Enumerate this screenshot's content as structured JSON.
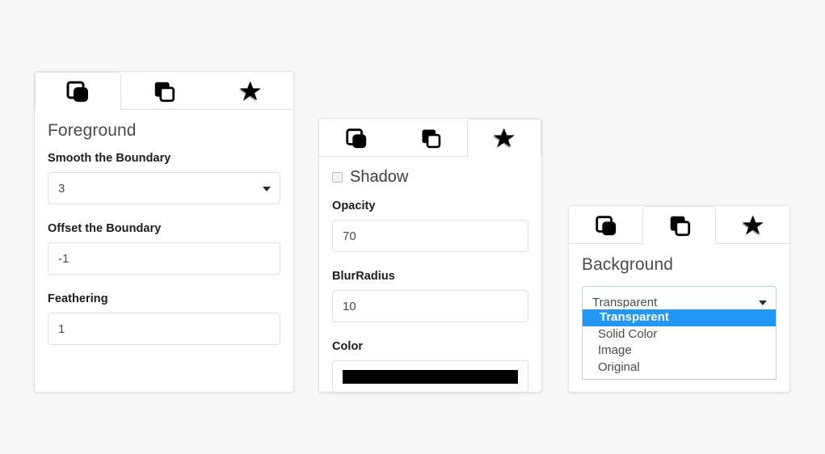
{
  "theme": {
    "page_background": "#f7f7f8",
    "panel_background": "#ffffff",
    "accent_highlight": "#2196f3",
    "border": "#e0e0e3",
    "swatch_color": "#000000"
  },
  "icons": {
    "tab1": "layers-filled-front-icon",
    "tab2": "layers-outline-front-icon",
    "tab3": "star-icon",
    "caret": "chevron-down-icon",
    "checkbox": "checkbox-unchecked-icon"
  },
  "panels": {
    "foreground": {
      "active_tab_index": 0,
      "tabs": [
        {
          "name": "tab-foreground",
          "icon": "layers-filled-front-icon"
        },
        {
          "name": "tab-background",
          "icon": "layers-outline-front-icon"
        },
        {
          "name": "tab-shadow",
          "icon": "star-icon"
        }
      ],
      "title": "Foreground",
      "fields": [
        {
          "label": "Smooth the Boundary",
          "value": "3",
          "type": "select"
        },
        {
          "label": "Offset the Boundary",
          "value": "-1",
          "type": "text"
        },
        {
          "label": "Feathering",
          "value": "1",
          "type": "text"
        }
      ]
    },
    "shadow": {
      "active_tab_index": 2,
      "tabs": [
        {
          "name": "tab-foreground",
          "icon": "layers-filled-front-icon"
        },
        {
          "name": "tab-background",
          "icon": "layers-outline-front-icon"
        },
        {
          "name": "tab-shadow",
          "icon": "star-icon"
        }
      ],
      "checkbox_label": "Shadow",
      "checkbox_checked": false,
      "fields": [
        {
          "label": "Opacity",
          "value": "70",
          "type": "text"
        },
        {
          "label": "BlurRadius",
          "value": "10",
          "type": "text"
        },
        {
          "label": "Color",
          "value": "#000000",
          "type": "color"
        }
      ]
    },
    "background": {
      "active_tab_index": 1,
      "tabs": [
        {
          "name": "tab-foreground",
          "icon": "layers-filled-front-icon"
        },
        {
          "name": "tab-background",
          "icon": "layers-outline-front-icon"
        },
        {
          "name": "tab-shadow",
          "icon": "star-icon"
        }
      ],
      "title": "Background",
      "select": {
        "value": "Transparent",
        "open": true,
        "options": [
          "Transparent",
          "Solid Color",
          "Image",
          "Original"
        ],
        "selected_index": 0
      }
    }
  }
}
